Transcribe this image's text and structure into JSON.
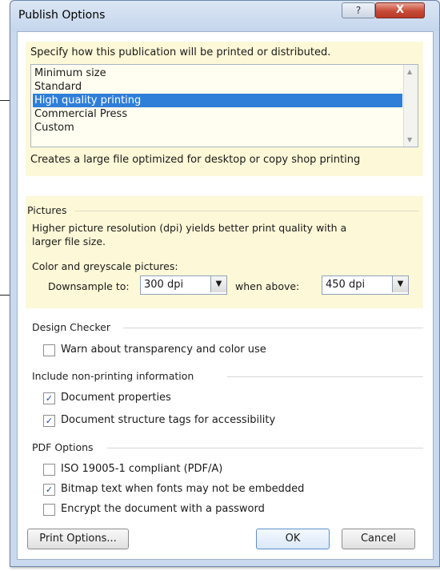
{
  "window": {
    "title": "Publish Options",
    "help_glyph": "?",
    "close_glyph": "X"
  },
  "publish": {
    "prompt": "Specify how this publication will be printed or distributed.",
    "options": [
      "Minimum size",
      "Standard",
      "High quality printing",
      "Commercial Press",
      "Custom"
    ],
    "selected_index": 2,
    "description": "Creates a large file optimized for desktop or copy shop printing"
  },
  "pictures": {
    "heading": "Pictures",
    "note_line1": "Higher picture resolution (dpi) yields better print quality with a",
    "note_line2": "larger file size.",
    "color_label": "Color and greyscale pictures:",
    "downsample_label": "Downsample to:",
    "downsample_value": "300 dpi",
    "when_above_label": "when above:",
    "when_above_value": "450 dpi"
  },
  "design_checker": {
    "heading": "Design Checker",
    "transparency_label": "Warn about transparency and color use",
    "transparency_checked": false
  },
  "non_printing": {
    "heading": "Include non-printing information",
    "doc_props_label": "Document properties",
    "doc_props_checked": true,
    "struct_tags_label": "Document structure tags for accessibility",
    "struct_tags_checked": true
  },
  "pdf": {
    "heading": "PDF Options",
    "iso_label": "ISO 19005-1 compliant (PDF/A)",
    "iso_checked": false,
    "bitmap_label": "Bitmap text when fonts may not be embedded",
    "bitmap_checked": true,
    "encrypt_label": "Encrypt the document with a password",
    "encrypt_checked": false
  },
  "buttons": {
    "print_options": "Print Options...",
    "ok": "OK",
    "cancel": "Cancel"
  },
  "icons": {
    "check": "checkmark-icon",
    "dropdown": "chevron-down-icon",
    "scroll_up": "scroll-up-arrow-icon",
    "scroll_down": "scroll-down-arrow-icon"
  },
  "colors": {
    "selection": "#2f7ed8",
    "panel_highlight": "#fdf8d7",
    "close_button": "#c74a36"
  }
}
